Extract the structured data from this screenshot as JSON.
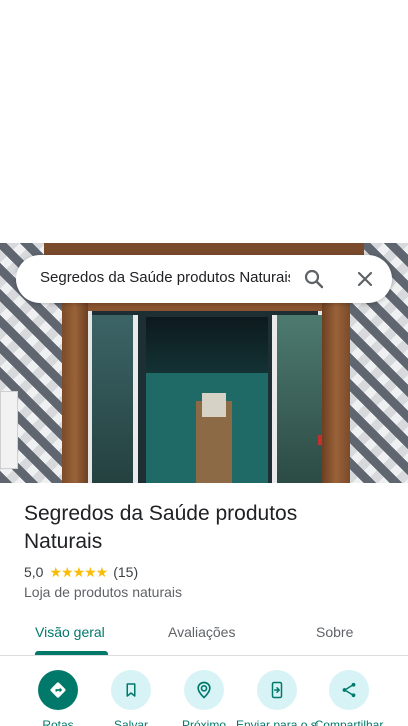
{
  "search": {
    "query": "Segredos da Saúde produtos Naturais"
  },
  "place": {
    "name": "Segredos da Saúde produtos Naturais",
    "rating": "5,0",
    "rating_stars": 5,
    "review_count": "(15)",
    "category": "Loja de produtos naturais"
  },
  "tabs": [
    {
      "label": "Visão geral",
      "active": true
    },
    {
      "label": "Avaliações",
      "active": false
    },
    {
      "label": "Sobre",
      "active": false
    }
  ],
  "actions": [
    {
      "label": "Rotas",
      "icon": "directions-icon"
    },
    {
      "label": "Salvar",
      "icon": "bookmark-icon"
    },
    {
      "label": "Próximo",
      "icon": "nearby-icon"
    },
    {
      "label": "Enviar para o smartphone",
      "icon": "send-to-phone-icon"
    },
    {
      "label": "Compartilhar",
      "icon": "share-icon"
    }
  ],
  "colors": {
    "accent": "#00796b",
    "star": "#fbbc04",
    "action_bg": "#d7f3f6"
  }
}
